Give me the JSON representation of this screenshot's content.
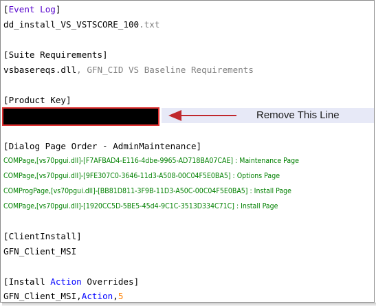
{
  "event_log": {
    "open": "[",
    "event": "Event",
    "space": " ",
    "log": "Log",
    "close": "]"
  },
  "event_file": {
    "name": "dd_install_VS_VSTSCORE_100",
    "ext": ".txt"
  },
  "suite_header": "[Suite Requirements]",
  "suite_value": {
    "name": "vsbasereqs.dll",
    "rest": ", GFN_CID VS Baseline Requirements"
  },
  "product_key_header": "[Product Key]",
  "annotation": {
    "label": "Remove This Line"
  },
  "dialog_header": "[Dialog Page Order - AdminMaintenance]",
  "dialog_lines": [
    "COMPage,[vs70pgui.dll]-[F7AFBAD4-E116-4dbe-9965-AD718BA07CAE] : Maintenance Page",
    "COMPage,[vs70pgui.dll]-[9FE307C0-3646-11d3-A508-00C04F5E0BA5] : Options Page",
    "COMProgPage,[vs70pgui.dll]-[BB81D811-3F9B-11D3-A50C-00C04F5E0BA5] : Install Page",
    "COMPage,[vs70pgui.dll]-[1920CC5D-5BE5-45d4-9C1C-3513D334C71C] : Install Page"
  ],
  "client_install_header": "[ClientInstall]",
  "client_install_value": "GFN_Client_MSI",
  "overrides_header": {
    "open": "[Install ",
    "action": "Action",
    "close": " Overrides]"
  },
  "overrides_value": {
    "name": "GFN_Client_MSI",
    "comma1": ",",
    "action": "Action",
    "comma2": ",",
    "num": "5"
  },
  "colors": {
    "keyword": "#5500cc",
    "keyword_blue": "#0000ff",
    "comment_gray": "#808080",
    "green_text": "#008000",
    "number": "#ff8000",
    "arrow_red": "#c0282d",
    "box_border": "#e03030"
  },
  "icons": {
    "arrow": "left-arrow-icon"
  }
}
